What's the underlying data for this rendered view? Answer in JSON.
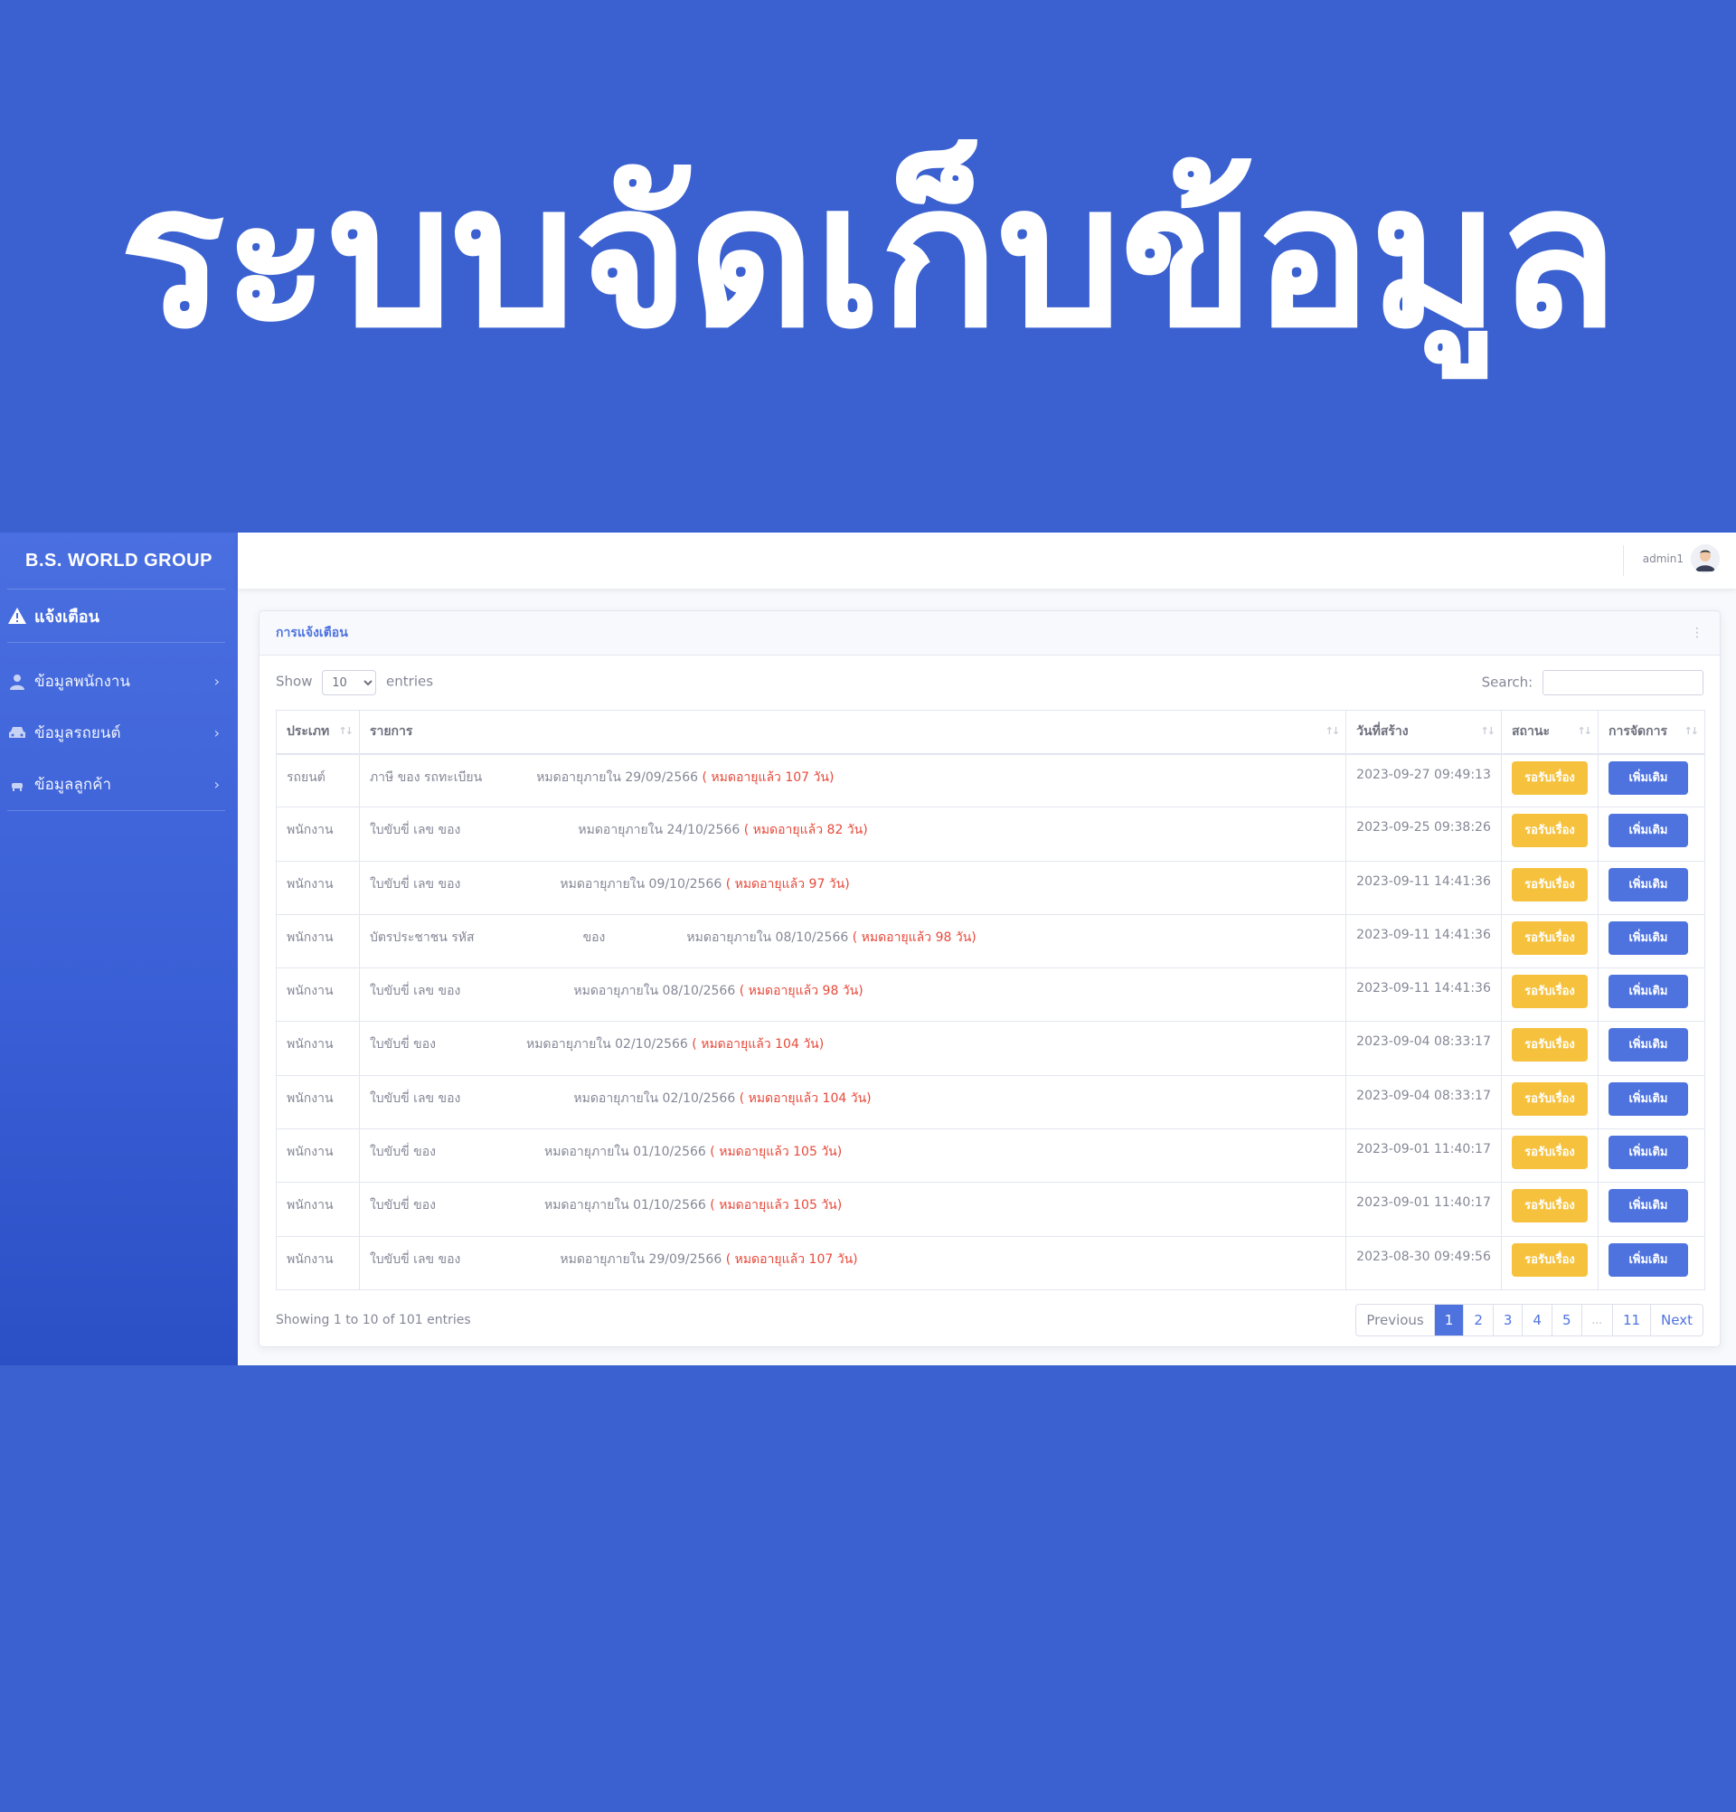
{
  "hero": {
    "title": "ระบบจัดเก็บข้อมูล"
  },
  "sidebar": {
    "brand": "B.S. WORLD GROUP",
    "alert_label": "แจ้งเตือน",
    "items": [
      {
        "label": "ข้อมูลพนักงาน",
        "icon": "user-icon"
      },
      {
        "label": "ข้อมูลรถยนต์",
        "icon": "car-icon"
      },
      {
        "label": "ข้อมูลลูกค้า",
        "icon": "customer-icon"
      }
    ]
  },
  "topbar": {
    "username": "admin1"
  },
  "card": {
    "title": "การแจ้งเตือน",
    "show_label": "Show",
    "entries_value": "10",
    "entries_label": "entries",
    "search_label": "Search:",
    "headers": [
      "ประเภท",
      "รายการ",
      "วันที่สร้าง",
      "สถานะ",
      "การจัดการ"
    ],
    "rows": [
      {
        "type": "รถยนต์",
        "item": "ภาษี ของ รถทะเบียน",
        "due": "หมดอายุภายใน 29/09/2566",
        "warn": "( หมดอายุแล้ว 107 วัน)",
        "created": "2023-09-27 09:49:13",
        "status": "รอรับเรื่อง",
        "action": "เพิ่มเติม"
      },
      {
        "type": "พนักงาน",
        "item": "ใบขับขี่ เลข ของ",
        "due": "หมดอายุภายใน 24/10/2566",
        "warn": "( หมดอายุแล้ว 82 วัน)",
        "created": "2023-09-25 09:38:26",
        "status": "รอรับเรื่อง",
        "action": "เพิ่มเติม"
      },
      {
        "type": "พนักงาน",
        "item": "ใบขับขี่ เลข ของ",
        "due": "หมดอายุภายใน 09/10/2566",
        "warn": "( หมดอายุแล้ว 97 วัน)",
        "created": "2023-09-11 14:41:36",
        "status": "รอรับเรื่อง",
        "action": "เพิ่มเติม"
      },
      {
        "type": "พนักงาน",
        "item": "บัตรประชาชน รหัส",
        "item2": "ของ",
        "due": "หมดอายุภายใน 08/10/2566",
        "warn": "( หมดอายุแล้ว 98 วัน)",
        "created": "2023-09-11 14:41:36",
        "status": "รอรับเรื่อง",
        "action": "เพิ่มเติม"
      },
      {
        "type": "พนักงาน",
        "item": "ใบขับขี่ เลข ของ",
        "due": "หมดอายุภายใน 08/10/2566",
        "warn": "( หมดอายุแล้ว 98 วัน)",
        "created": "2023-09-11 14:41:36",
        "status": "รอรับเรื่อง",
        "action": "เพิ่มเติม"
      },
      {
        "type": "พนักงาน",
        "item": "ใบขับขี่ ของ",
        "due": "หมดอายุภายใน 02/10/2566",
        "warn": "( หมดอายุแล้ว 104 วัน)",
        "created": "2023-09-04 08:33:17",
        "status": "รอรับเรื่อง",
        "action": "เพิ่มเติม"
      },
      {
        "type": "พนักงาน",
        "item": "ใบขับขี่ เลข ของ",
        "due": "หมดอายุภายใน 02/10/2566",
        "warn": "( หมดอายุแล้ว 104 วัน)",
        "created": "2023-09-04 08:33:17",
        "status": "รอรับเรื่อง",
        "action": "เพิ่มเติม"
      },
      {
        "type": "พนักงาน",
        "item": "ใบขับขี่ ของ",
        "due": "หมดอายุภายใน 01/10/2566",
        "warn": "( หมดอายุแล้ว 105 วัน)",
        "created": "2023-09-01 11:40:17",
        "status": "รอรับเรื่อง",
        "action": "เพิ่มเติม"
      },
      {
        "type": "พนักงาน",
        "item": "ใบขับขี่ ของ",
        "due": "หมดอายุภายใน 01/10/2566",
        "warn": "( หมดอายุแล้ว 105 วัน)",
        "created": "2023-09-01 11:40:17",
        "status": "รอรับเรื่อง",
        "action": "เพิ่มเติม"
      },
      {
        "type": "พนักงาน",
        "item": "ใบขับขี่ เลข ของ",
        "due": "หมดอายุภายใน 29/09/2566",
        "warn": "( หมดอายุแล้ว 107 วัน)",
        "created": "2023-08-30 09:49:56",
        "status": "รอรับเรื่อง",
        "action": "เพิ่มเติม"
      }
    ],
    "showing": "Showing 1 to 10 of 101 entries",
    "pagination": [
      "Previous",
      "1",
      "2",
      "3",
      "4",
      "5",
      "...",
      "11",
      "Next"
    ]
  },
  "colors": {
    "background": "#3b61d0",
    "primary": "#4e73df",
    "warning": "#f6c23e",
    "danger": "#e74a3b"
  }
}
